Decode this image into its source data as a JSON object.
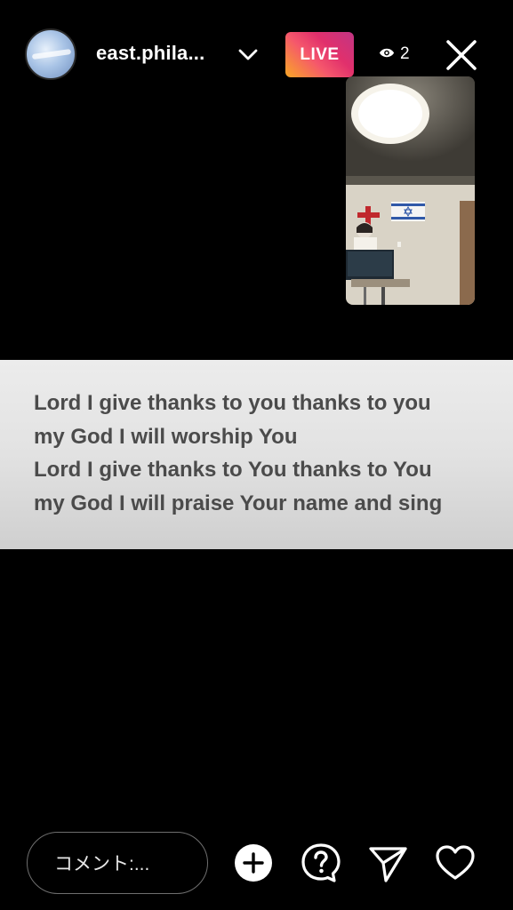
{
  "header": {
    "username": "east.phila...",
    "live_label": "LIVE",
    "viewer_count": "2",
    "live_gradient": [
      "#f9a825",
      "#f5576c",
      "#e1306c",
      "#c13584"
    ]
  },
  "lyrics": {
    "lines": [
      "Lord I give thanks to you thanks to you",
      "my God I will worship You",
      "Lord I give thanks to You  thanks to You",
      "my God I will praise Your name and sing"
    ]
  },
  "footer": {
    "comment_placeholder": "コメント:...",
    "icons": [
      "add-icon",
      "question-icon",
      "send-icon",
      "heart-icon"
    ]
  },
  "colors": {
    "background": "#000000",
    "banner": "#e2e2e2",
    "lyric_text": "#4b4b4b"
  }
}
